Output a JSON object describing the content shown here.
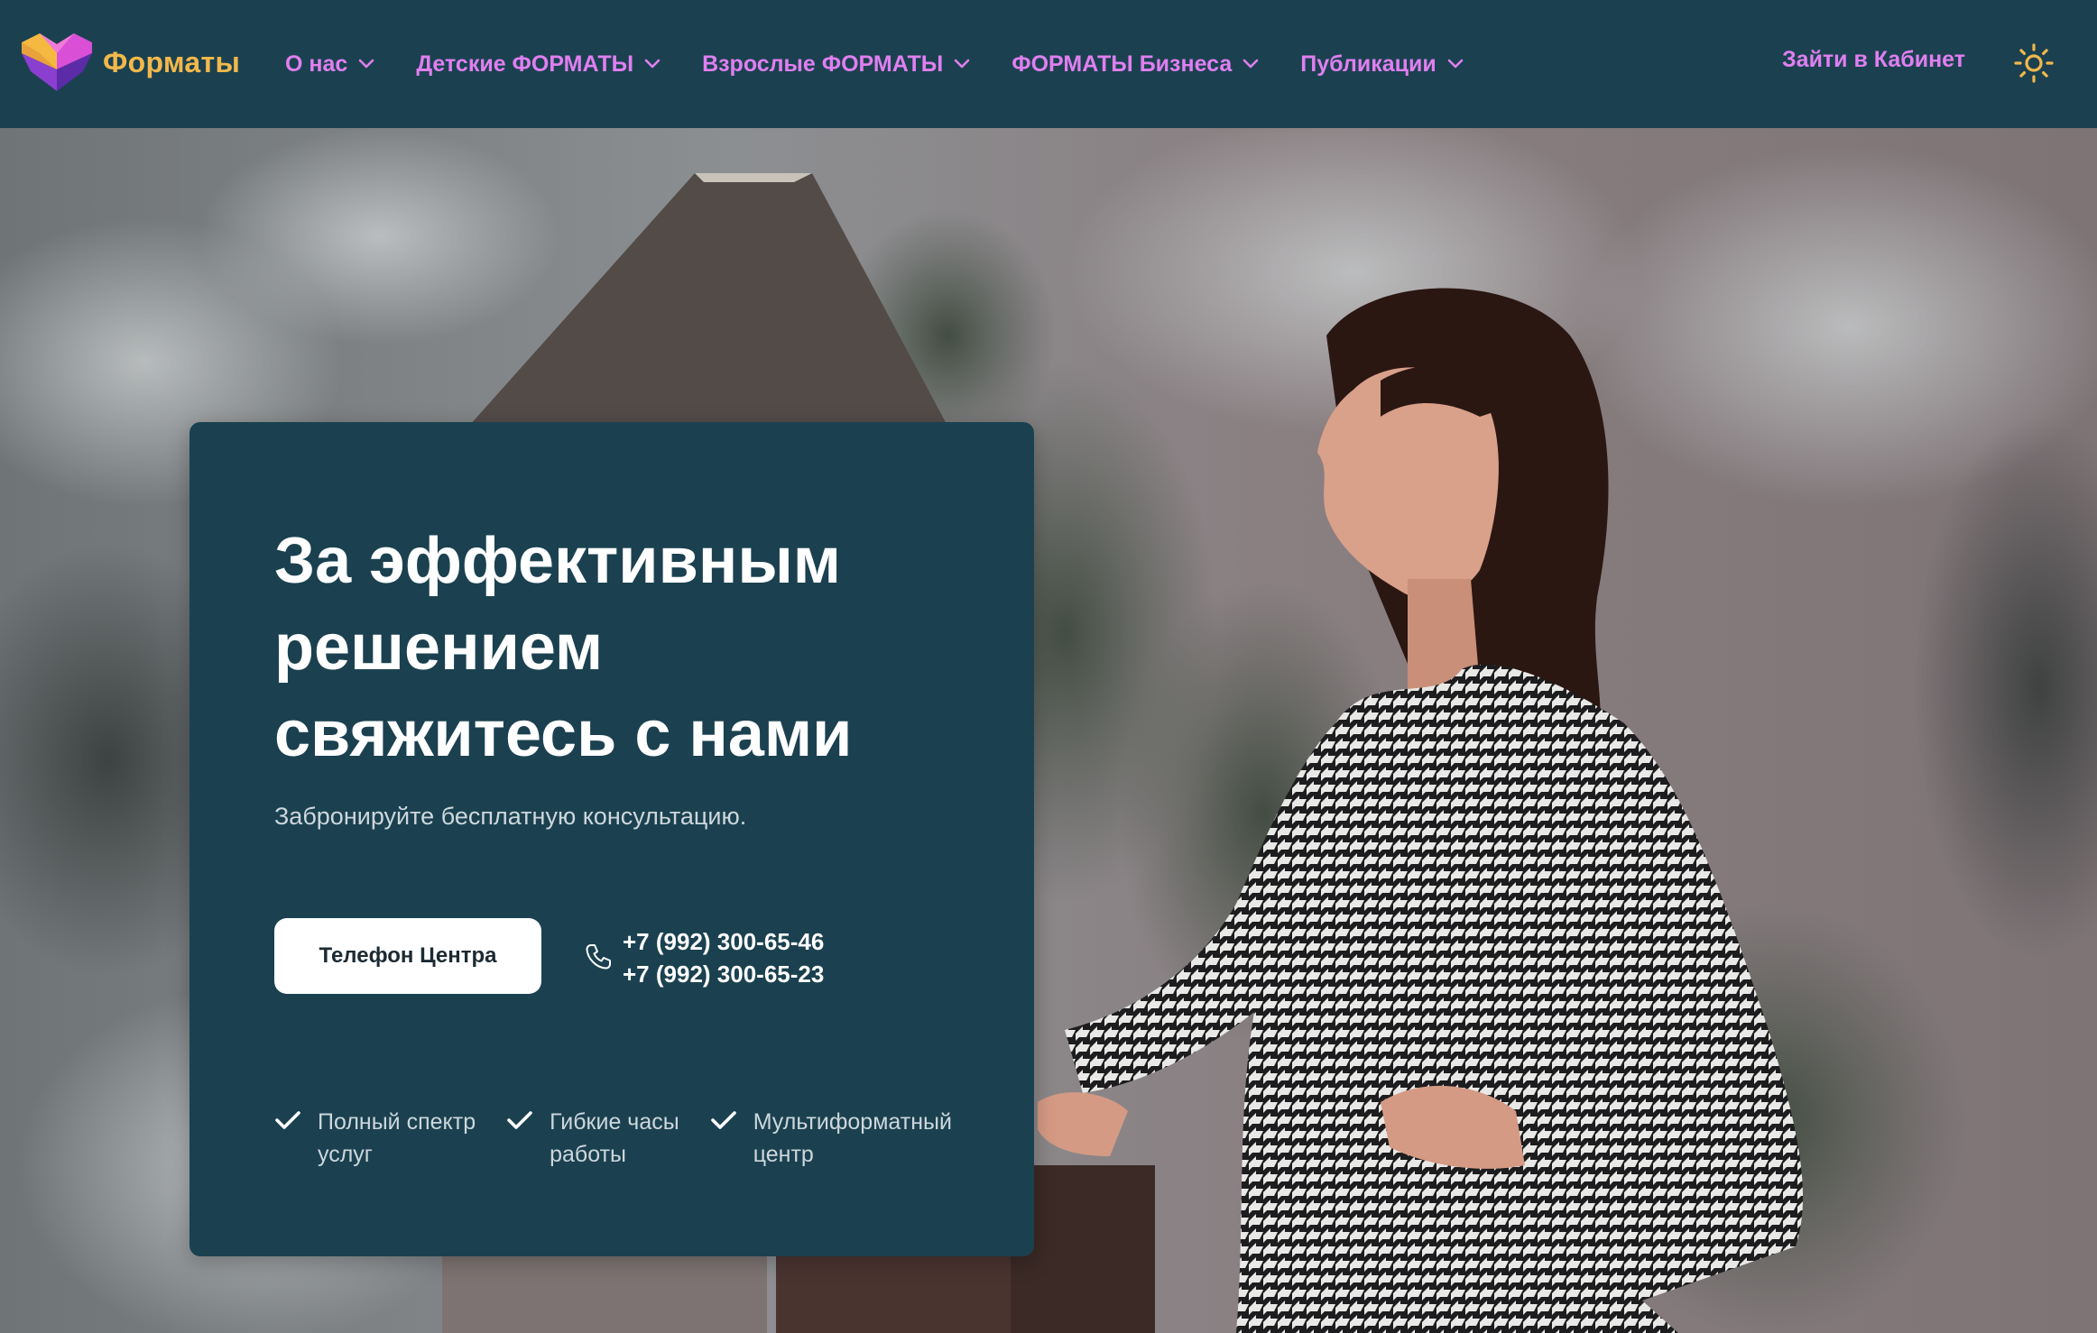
{
  "header": {
    "logo_text": "Форматы",
    "nav": [
      {
        "label": "О нас"
      },
      {
        "label": "Детские ФОРМАТЫ"
      },
      {
        "label": "Взрослые ФОРМАТЫ"
      },
      {
        "label": "ФОРМАТЫ Бизнеса"
      },
      {
        "label": "Публикации"
      }
    ],
    "login_label": "Зайти в Кабинет",
    "theme_icon": "sun-icon"
  },
  "hero": {
    "title_lines": [
      "За эффективным",
      "решением",
      "свяжитесь с нами"
    ],
    "subtitle": "Забронируйте бесплатную консультацию.",
    "phone_button_label": "Телефон Центра",
    "phones": [
      "+7 (992) 300-65-46",
      "+7 (992) 300-65-23"
    ],
    "features": [
      {
        "line1": "Полный спектр",
        "line2": "услуг"
      },
      {
        "line1": "Гибкие часы",
        "line2": "работы"
      },
      {
        "line1": "Мультиформатный",
        "line2": "центр"
      }
    ]
  },
  "colors": {
    "header_bg": "#1b4150",
    "card_bg": "#1b4150",
    "nav_link": "#e07ff0",
    "logo_text": "#f2b84b",
    "sun_icon": "#f2b84b"
  }
}
